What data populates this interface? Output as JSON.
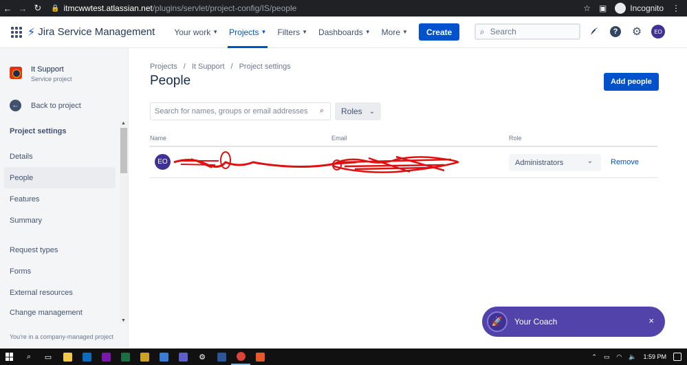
{
  "browser": {
    "url_host": "itmcwwtest.atlassian.net",
    "url_path": "/plugins/servlet/project-config/IS/people",
    "incognito_label": "Incognito"
  },
  "header": {
    "product": "Jira Service Management",
    "nav": [
      {
        "label": "Your work",
        "active": false
      },
      {
        "label": "Projects",
        "active": true
      },
      {
        "label": "Filters",
        "active": false
      },
      {
        "label": "Dashboards",
        "active": false
      },
      {
        "label": "More",
        "active": false
      }
    ],
    "create_label": "Create",
    "search_placeholder": "Search",
    "avatar_initials": "EO"
  },
  "sidebar": {
    "project_name": "It Support",
    "project_type": "Service project",
    "back_label": "Back to project",
    "section_title": "Project settings",
    "items": [
      {
        "label": "Details",
        "selected": false
      },
      {
        "label": "People",
        "selected": true
      },
      {
        "label": "Features",
        "selected": false
      },
      {
        "label": "Summary",
        "selected": false
      },
      {
        "label": "Request types",
        "selected": false
      },
      {
        "label": "Forms",
        "selected": false
      },
      {
        "label": "External resources",
        "selected": false
      },
      {
        "label": "Change management",
        "selected": false
      }
    ],
    "footer_note": "You're in a company-managed project"
  },
  "main": {
    "breadcrumbs": [
      "Projects",
      "/",
      "It Support",
      "/",
      "Project settings"
    ],
    "title": "People",
    "add_people_label": "Add people",
    "search_placeholder": "Search for names, groups or email addresses",
    "roles_label": "Roles",
    "table": {
      "headers": [
        "Name",
        "Email",
        "Role"
      ],
      "rows": [
        {
          "avatar": "EO",
          "role": "Administrators",
          "action": "Remove"
        }
      ]
    }
  },
  "coach": {
    "label": "Your Coach",
    "close_symbol": "×"
  },
  "taskbar": {
    "time": "1:59 PM"
  },
  "colors": {
    "brand_blue": "#0052cc",
    "coach_purple": "#5243aa",
    "redaction_red": "#e01010"
  }
}
